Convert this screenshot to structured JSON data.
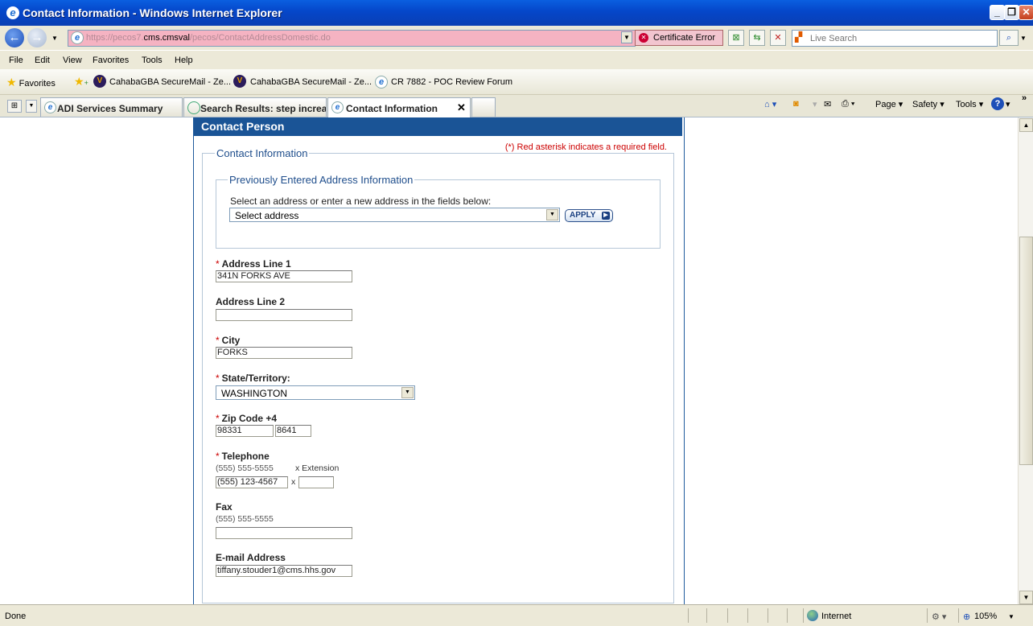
{
  "window": {
    "title": "Contact Information - Windows Internet Explorer"
  },
  "addressbar": {
    "url_prefix": "https://pecos7.",
    "url_domain": "cms.cmsval",
    "url_path": "/pecos/ContactAddressDomestic.do",
    "certificate_error": "Certificate Error",
    "search_placeholder": "Live Search"
  },
  "menu": {
    "file": "File",
    "edit": "Edit",
    "view": "View",
    "favorites": "Favorites",
    "tools": "Tools",
    "help": "Help"
  },
  "favorites_bar": {
    "label": "Favorites",
    "items": [
      "CahabaGBA SecureMail - Ze...",
      "CahabaGBA SecureMail - Ze...",
      "CR 7882 - POC Review Forum"
    ]
  },
  "tabs": [
    "ADI Services Summary",
    "Search Results: step increas...",
    "Contact Information"
  ],
  "command_bar": {
    "page": "Page",
    "safety": "Safety",
    "tools": "Tools"
  },
  "form": {
    "panel_title": "Contact Person",
    "required_note": "(*) Red asterisk indicates a required field.",
    "legend": "Contact Information",
    "prev_legend": "Previously Entered Address Information",
    "prev_instructions": "Select an address or enter a new address in the fields below:",
    "address_select": "Select address",
    "apply": "APPLY",
    "required_mark": "*",
    "address1_label": "Address Line 1",
    "address1_value": "341N FORKS AVE",
    "address2_label": "Address Line 2",
    "address2_value": "",
    "city_label": "City",
    "city_value": "FORKS",
    "state_label": "State/Territory:",
    "state_value": "WASHINGTON",
    "zip_label": "Zip Code +4",
    "zip_value": "98331",
    "zip4_value": "8641",
    "phone_label": "Telephone",
    "phone_hint": "(555) 555-5555",
    "ext_hint": "x  Extension",
    "phone_value": "(555) 123-4567",
    "ext_sep": "x",
    "ext_value": "",
    "fax_label": "Fax",
    "fax_hint": "(555) 555-5555",
    "fax_value": "",
    "email_label": "E-mail Address",
    "email_value": "tiffany.stouder1@cms.hhs.gov"
  },
  "status": {
    "left": "Done",
    "zone": "Internet",
    "zoom": "105%"
  },
  "colors": {
    "title_blue": "#0546c9",
    "panel_blue": "#1a5496",
    "required_red": "#cc0000",
    "url_error_pink": "#f5b3c2"
  }
}
